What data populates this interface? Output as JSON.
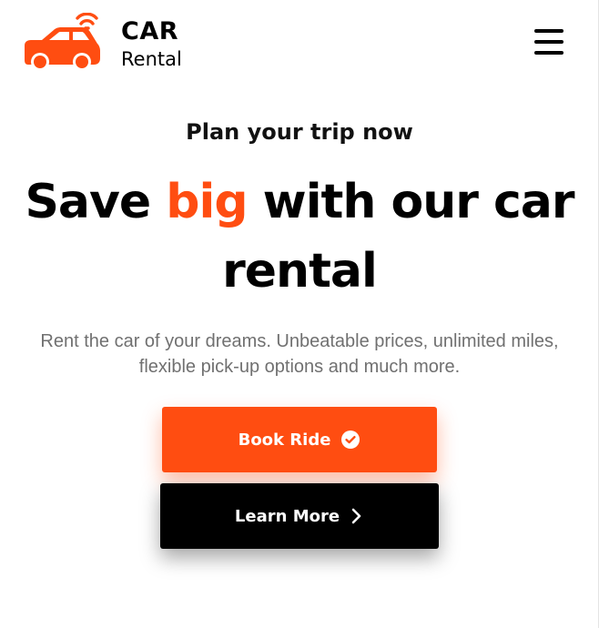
{
  "header": {
    "logo": {
      "title": "CAR",
      "subtitle": "Rental",
      "icon": "car-wifi-icon"
    },
    "menu_icon": "hamburger-menu-icon"
  },
  "hero": {
    "kicker": "Plan your trip now",
    "title_before": "Save ",
    "title_accent": "big",
    "title_after": " with our car rental",
    "description": "Rent the car of your dreams. Unbeatable prices, unlimited miles, flexible pick-up options and much more."
  },
  "buttons": {
    "book": {
      "label": "Book Ride",
      "icon": "check-circle-icon"
    },
    "learn": {
      "label": "Learn More",
      "icon": "chevron-right-icon"
    }
  },
  "colors": {
    "accent": "#ff4d11",
    "dark": "#000000",
    "muted_text": "#707070"
  }
}
